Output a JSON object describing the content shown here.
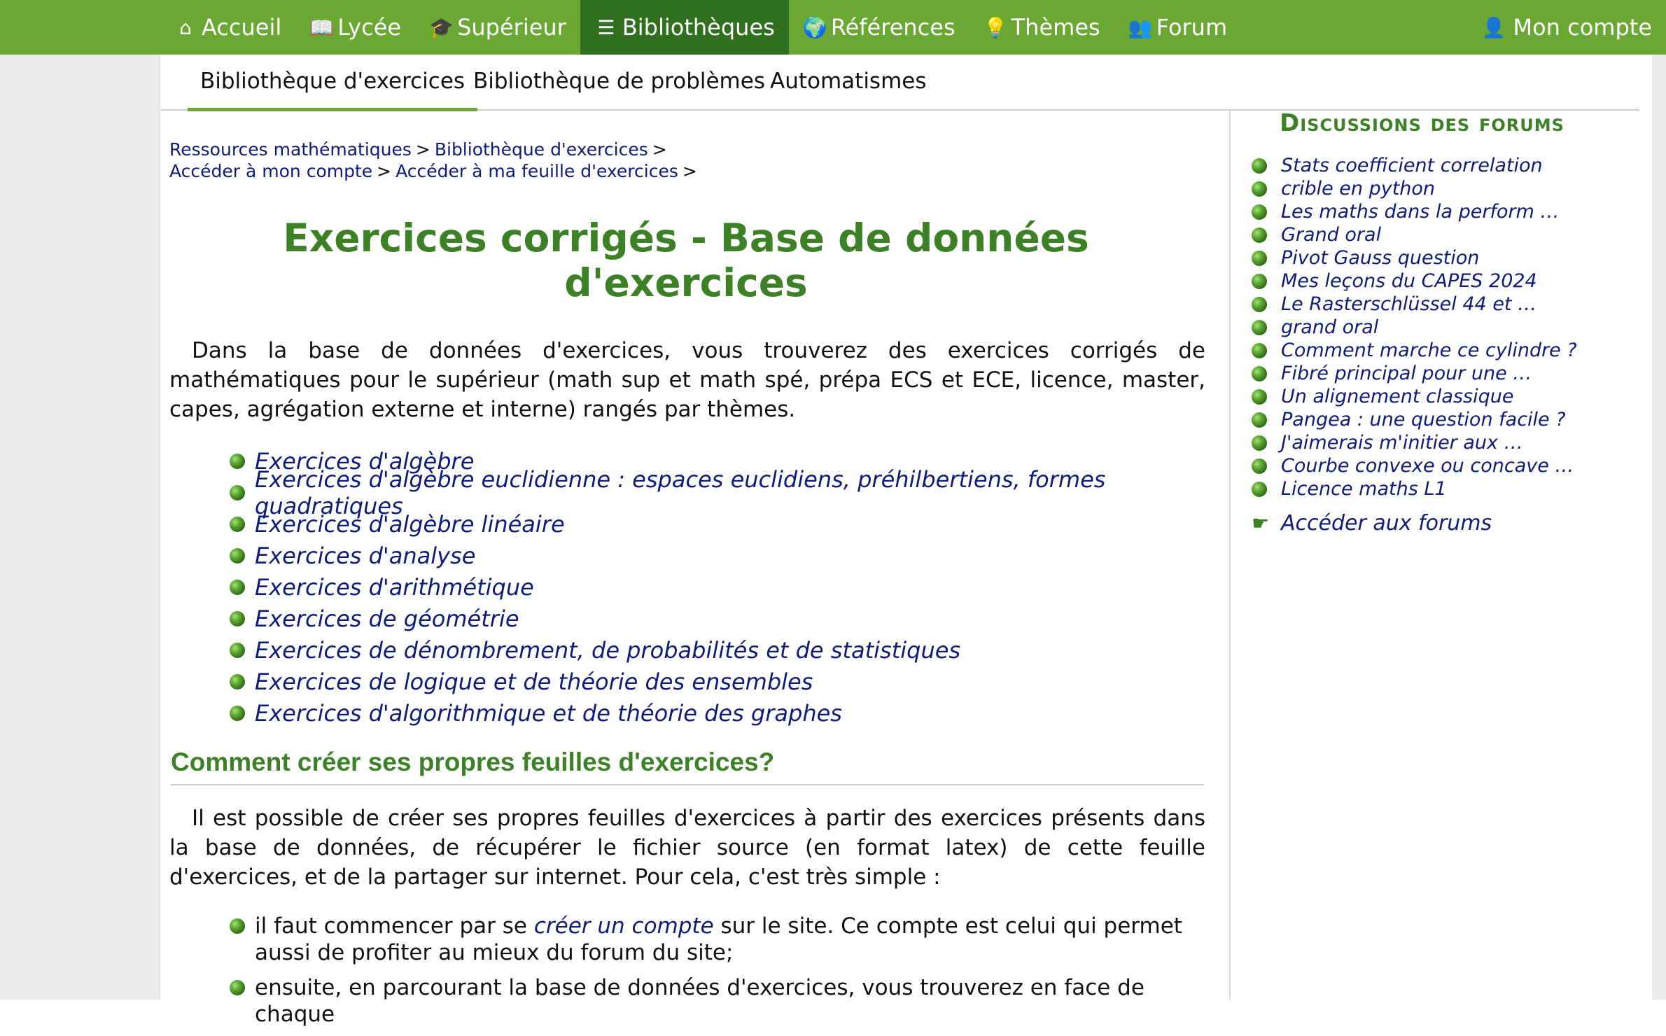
{
  "nav": {
    "items": [
      {
        "label": "Accueil",
        "icon": "home-icon"
      },
      {
        "label": "Lycée",
        "icon": "book-icon"
      },
      {
        "label": "Supérieur",
        "icon": "graduation-cap-icon"
      },
      {
        "label": "Bibliothèques",
        "icon": "library-icon",
        "active": true
      },
      {
        "label": "Références",
        "icon": "globe-icon"
      },
      {
        "label": "Thèmes",
        "icon": "lightbulb-icon"
      },
      {
        "label": "Forum",
        "icon": "people-icon"
      }
    ],
    "account": "Mon compte"
  },
  "subnav": {
    "tabs": [
      {
        "label": "Bibliothèque d'exercices",
        "active": true
      },
      {
        "label": "Bibliothèque de problèmes"
      },
      {
        "label": "Automatismes"
      }
    ]
  },
  "breadcrumb": {
    "items": [
      "Ressources mathématiques",
      "Bibliothèque d'exercices",
      "Accéder à mon compte",
      "Accéder à ma feuille d'exercices"
    ],
    "separator": ">"
  },
  "main": {
    "title_line1": "Exercices corrigés - Base de données",
    "title_line2": "d'exercices",
    "intro": "Dans la base de données d'exercices, vous trouverez des exercices corrigés de mathématiques pour le supérieur (math sup et math spé, prépa ECS et ECE, licence, master, capes, agrégation externe et interne) rangés par thèmes.",
    "exercise_links": [
      "Exercices d'algèbre",
      "Exercices d'algèbre euclidienne : espaces euclidiens, préhilbertiens, formes quadratiques",
      "Exercices d'algèbre linéaire",
      "Exercices d'analyse",
      "Exercices d'arithmétique",
      "Exercices de géométrie",
      "Exercices de dénombrement, de probabilités et de statistiques",
      "Exercices de logique et de théorie des ensembles",
      "Exercices d'algorithmique et de théorie des graphes"
    ],
    "section_heading": "Comment créer ses propres feuilles d'exercices?",
    "section_text": "Il est possible de créer ses propres feuilles d'exercices à partir des exercices présents dans la base de données, de récupérer le fichier source (en format latex) de cette feuille d'exercices, et de la partager sur internet. Pour cela, c'est très simple :",
    "steps": {
      "step1_before": "il faut commencer par se",
      "step1_link": "créer un compte",
      "step1_after": "sur le site. Ce compte est celui qui permet aussi de profiter au mieux du forum du site;",
      "step2": "ensuite, en parcourant la base de données d'exercices, vous trouverez en face de chaque"
    }
  },
  "sidebar": {
    "title": "Discussions des forums",
    "topics": [
      "Stats coefficient correlation",
      "crible en python",
      "Les maths dans la perform …",
      "Grand oral",
      "Pivot Gauss question",
      "Mes leçons du CAPES 2024",
      "Le Rasterschlüssel 44 et …",
      "grand oral",
      "Comment marche ce cylindre ?",
      "Fibré principal pour une …",
      "Un alignement classique",
      "Pangea : une question facile ?",
      "J'aimerais m'initier aux …",
      "Courbe convexe ou concave …",
      "Licence maths L1"
    ],
    "access_label": "Accéder aux forums"
  },
  "colors": {
    "nav_green": "#6aa733",
    "nav_active": "#2f6f1e",
    "heading_green": "#3c8126",
    "link_blue": "#0d1c7a"
  }
}
